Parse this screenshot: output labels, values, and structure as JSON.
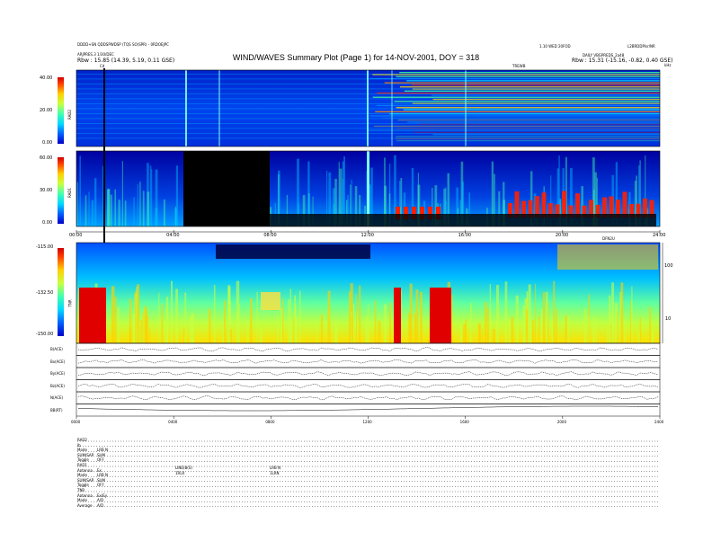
{
  "header": {
    "title": "WIND/WAVES Summary Plot (Page 1) for 14-NOV-2001, DOY = 318",
    "left_line1": "DDDD+SN QDDSPWDSP (TQS SO(SPR) - 0RDOEJPC",
    "left_line2": "ARJPRES.3 1/30/DEC",
    "left_rbw": "Rbw : 15.85 (14.39, 5.19, 0.11 GSE)",
    "right_line1": "1.10 WED 20FOD",
    "right_line2": "DAILY VBGPREDS_2a48",
    "right_rbw": "Rbw : 15.31 (-15.16, -0.82, 0.40 GSE)",
    "right_top": "L2BRDDPlsr/NR",
    "marker_label": "Cd",
    "center_small": "TREWB",
    "khz_label": "kHz",
    "day_label": "DFN2U"
  },
  "colors": {
    "background": "#000088",
    "colorbar_stops": [
      "#0000c8",
      "#0060ff",
      "#00d8ff",
      "#40ffb0",
      "#c8ff40",
      "#ffd000",
      "#ff4000",
      "#d00000"
    ]
  },
  "chart_data": [
    {
      "type": "heatmap",
      "name_panel": "rad2",
      "ylabel": "RAD2",
      "ytick_labels": [
        "40.00",
        "20.00",
        "0.00"
      ]
    },
    {
      "type": "heatmap",
      "name_panel": "rad1",
      "ylabel": "RAD1",
      "ytick_labels": [
        "60.00",
        "30.00",
        "0.00"
      ],
      "xtick_labels": [
        "00:00",
        "04:00",
        "08:00",
        "12:00",
        "16:00",
        "20:00",
        "24:00"
      ]
    },
    {
      "type": "heatmap",
      "name_panel": "tnr",
      "ylabel": "TNR",
      "ytick_labels": [
        "-115.00",
        "-132.50",
        "-150.00"
      ],
      "right_tick_labels": [
        "100",
        "10"
      ]
    },
    {
      "type": "line",
      "name_panel": "magnetometer",
      "series": [
        {
          "name": "B(ACE)"
        },
        {
          "name": "Bx(ACE)"
        },
        {
          "name": "By(ACE)"
        },
        {
          "name": "Bz(ACE)"
        },
        {
          "name": "N(ACE)"
        },
        {
          "name": "BB(RT)"
        }
      ],
      "xtick_labels": [
        "0000",
        "0400",
        "0800",
        "1200",
        "1600",
        "2000",
        "2400"
      ]
    }
  ],
  "footer": {
    "lines": [
      {
        "name": "RAD2",
        "value": ""
      },
      {
        "name": "Ib",
        "value": ""
      },
      {
        "name": "Mode",
        "value": "LRB N"
      },
      {
        "name": "SUM/SAP",
        "value": "SUM"
      },
      {
        "name": "Toggle",
        "value": "OFF"
      },
      {
        "name": "RAD1",
        "value": ""
      },
      {
        "name": "Antenna",
        "value": "Ex"
      },
      {
        "name": "Mode",
        "value": "LRB N"
      },
      {
        "name": "SUM/SAP",
        "value": "SUM"
      },
      {
        "name": "Toggle",
        "value": "OFF"
      },
      {
        "name": "TNR",
        "value": ""
      },
      {
        "name": "Antenna",
        "value": "Ex/Ey"
      },
      {
        "name": "Mode",
        "value": "A/D"
      },
      {
        "name": "Average",
        "value": "A/D"
      }
    ],
    "mid_text_1": "LINE(B(S)",
    "mid_text_2": "1RLR",
    "mid_text_3": "LRB N",
    "mid_text_4": "1LRN"
  }
}
